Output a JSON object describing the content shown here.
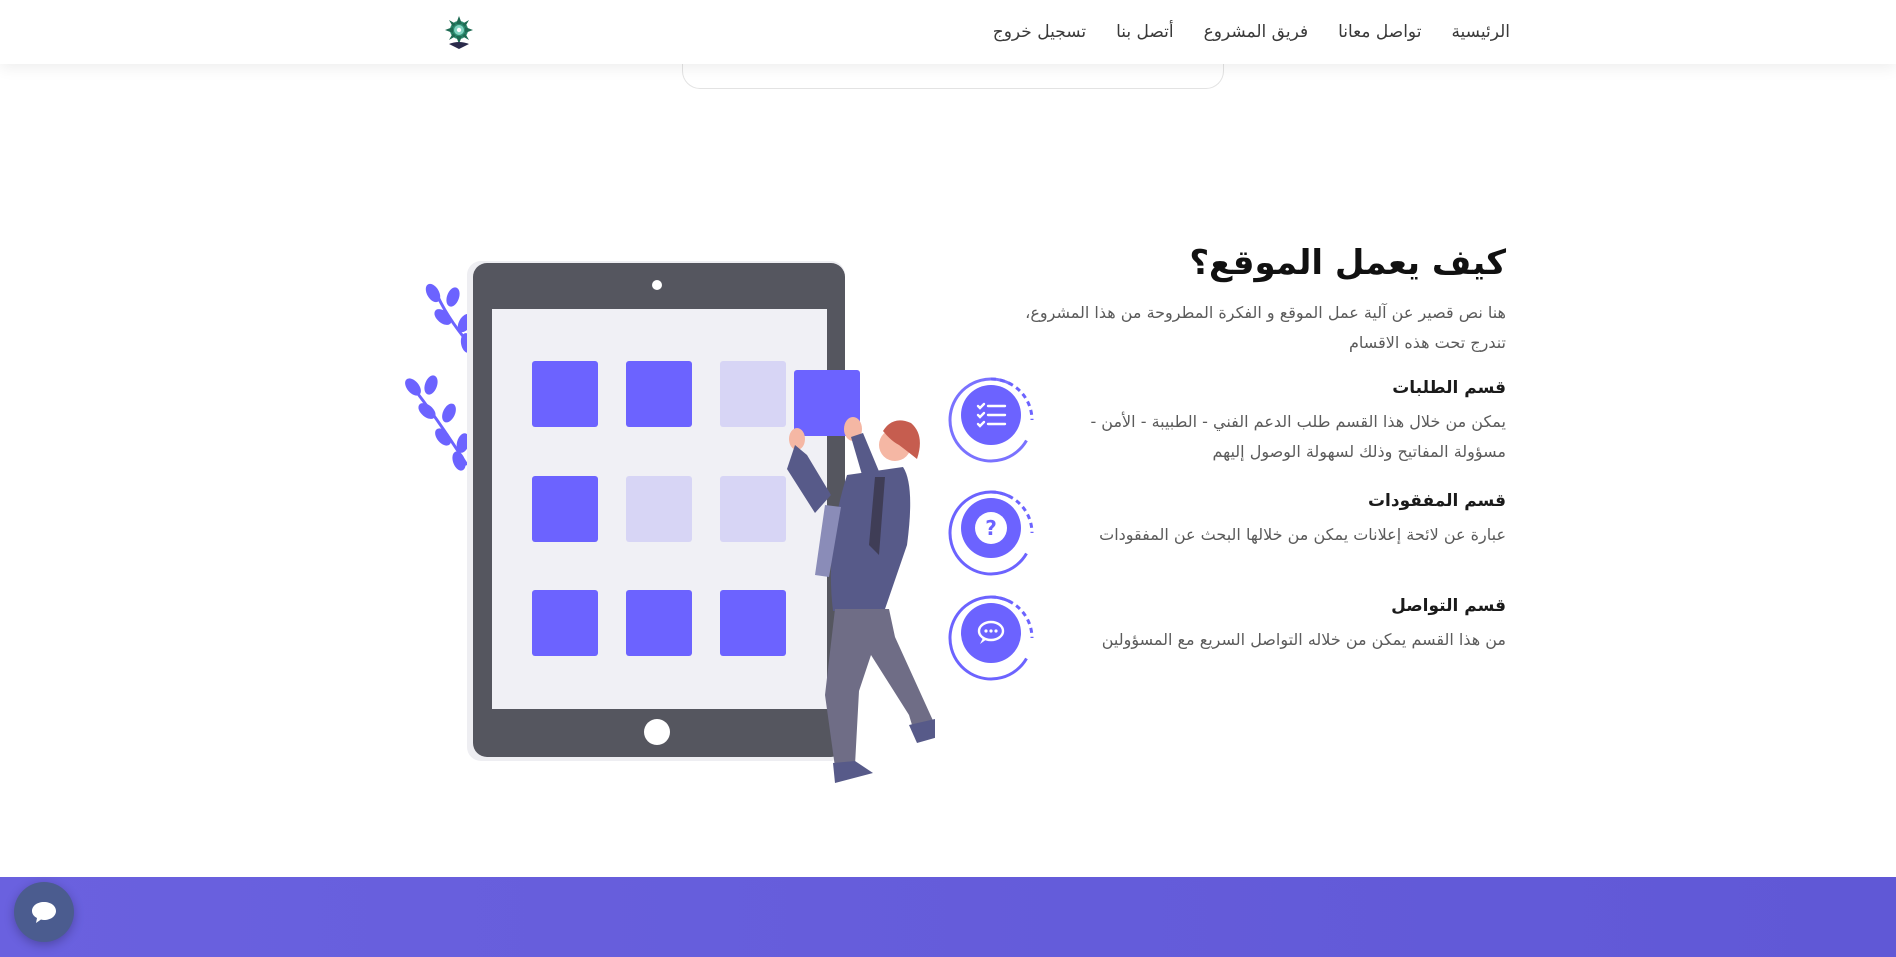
{
  "nav": {
    "items": [
      {
        "label": "الرئيسية"
      },
      {
        "label": "تواصل معانا"
      },
      {
        "label": "فريق المشروع"
      },
      {
        "label": "أتصل بنا"
      },
      {
        "label": "تسجيل خروج"
      }
    ]
  },
  "section": {
    "title": "كيف يعمل الموقع؟",
    "intro": "هنا نص قصير عن آلية عمل الموقع و الفكرة المطروحة من هذا المشروع، تندرج تحت هذه الاقسام",
    "features": [
      {
        "title": "قسم الطلبات",
        "desc": "يمكن من خلال هذا القسم طلب الدعم الفني - الطبيبة - الأمن - مسؤولة المفاتيح وذلك لسهولة الوصول إليهم",
        "icon": "list-check-icon"
      },
      {
        "title": "قسم المفقودات",
        "desc": "عبارة عن لائحة إعلانات يمكن من خلالها البحث عن المفقودات",
        "icon": "question-icon"
      },
      {
        "title": "قسم التواصل",
        "desc": "من هذا القسم يمكن من خلاله التواصل السريع مع المسؤولين",
        "icon": "chat-dots-icon"
      }
    ]
  },
  "colors": {
    "accent": "#6c63ff",
    "light_tile": "#d7d5f5",
    "tablet_frame": "#55565f",
    "footer": "#6a61df",
    "chat_button": "#4b5c8f"
  }
}
